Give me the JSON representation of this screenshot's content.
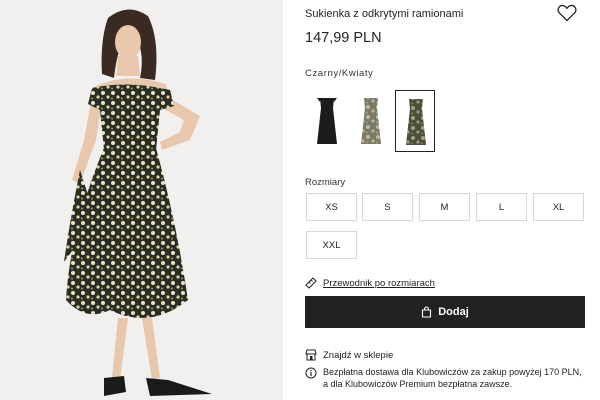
{
  "product": {
    "title": "Sukienka z odkrytymi ramionami",
    "price": "147,99 PLN",
    "color_label": "Czarny/Kwiaty",
    "color_swatches": [
      {
        "name": "black",
        "color": "#1c1c1c",
        "selected": false
      },
      {
        "name": "cream-floral",
        "color": "#d8d2c2",
        "selected": false
      },
      {
        "name": "green-floral",
        "color": "#6b6a4e",
        "selected": true
      }
    ]
  },
  "sizes": {
    "label": "Rozmiary",
    "options": [
      "XS",
      "S",
      "M",
      "L",
      "XL",
      "XXL"
    ]
  },
  "size_guide": {
    "label": "Przewodnik po rozmiarach",
    "icon": "ruler-icon"
  },
  "add_to_cart": {
    "label": "Dodaj",
    "icon": "bag-icon"
  },
  "store": {
    "label": "Znajdź w sklepie",
    "icon": "store-icon"
  },
  "delivery_info": {
    "text": "Bezpłatna dostawa dla Klubowiczów za zakup powyżej 170 PLN, a dla Klubowiczów Premium bezpłatna zawsze.",
    "icon": "info-icon"
  },
  "favorite": {
    "icon": "heart-icon"
  },
  "colors": {
    "button_bg": "#222222",
    "photo_bg": "#f1f0ee"
  }
}
